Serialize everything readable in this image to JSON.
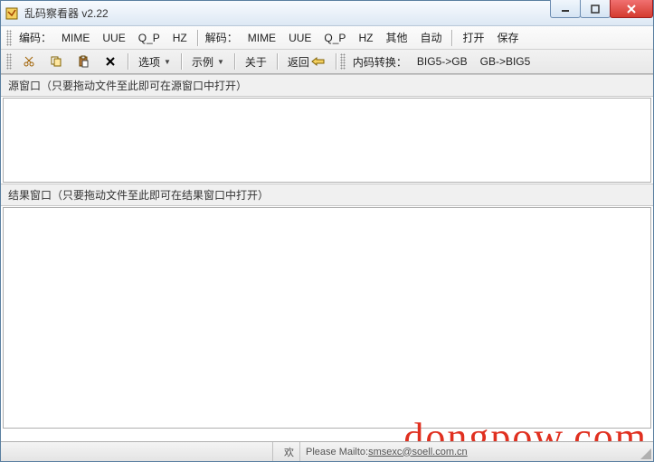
{
  "window": {
    "title": "乱码察看器 v2.22"
  },
  "toolbar1": {
    "encode_label": "编码：",
    "encode": {
      "mime": "MIME",
      "uue": "UUE",
      "qp": "Q_P",
      "hz": "HZ"
    },
    "decode_label": "解码：",
    "decode": {
      "mime": "MIME",
      "uue": "UUE",
      "qp": "Q_P",
      "hz": "HZ",
      "other": "其他",
      "auto": "自动"
    },
    "open": "打开",
    "save": "保存"
  },
  "toolbar2": {
    "options": "选项",
    "examples": "示例",
    "about": "关于",
    "back": "返回",
    "codeconv_label": "内码转换：",
    "big5gb": "BIG5->GB",
    "gbbig5": "GB->BIG5"
  },
  "panes": {
    "source_header": "源窗口（只要拖动文件至此即可在源窗口中打开）",
    "result_header": "结果窗口（只要拖动文件至此即可在结果窗口中打开）"
  },
  "status": {
    "hint_char": "欢",
    "mailto_prefix": "Please Mailto: ",
    "mailto_addr": "smsexc@soell.com.cn"
  },
  "watermark": "dongpow.com"
}
